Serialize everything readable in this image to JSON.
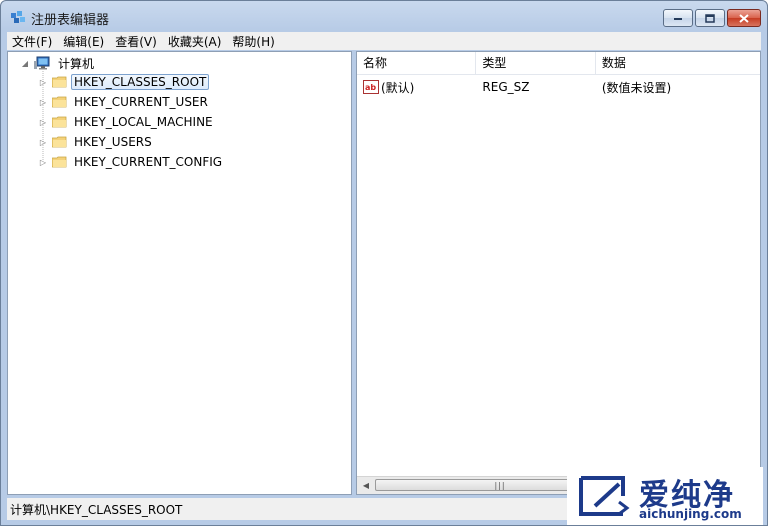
{
  "window": {
    "title": "注册表编辑器"
  },
  "menu": [
    "文件(F)",
    "编辑(E)",
    "查看(V)",
    "收藏夹(A)",
    "帮助(H)"
  ],
  "tree": {
    "root": "计算机",
    "items": [
      "HKEY_CLASSES_ROOT",
      "HKEY_CURRENT_USER",
      "HKEY_LOCAL_MACHINE",
      "HKEY_USERS",
      "HKEY_CURRENT_CONFIG"
    ],
    "selected": "HKEY_CLASSES_ROOT"
  },
  "list": {
    "headers": {
      "name": "名称",
      "type": "类型",
      "data": "数据"
    },
    "rows": [
      {
        "name": "(默认)",
        "type": "REG_SZ",
        "data": "(数值未设置)"
      }
    ]
  },
  "statusbar": {
    "path": "计算机\\HKEY_CLASSES_ROOT"
  },
  "watermark": {
    "brand": "爱纯净",
    "url": "aichunjing.com"
  },
  "colors": {
    "folder": "#f4d27a",
    "selection": "#dcebfc",
    "watermark_text": "#1d3a8a"
  }
}
